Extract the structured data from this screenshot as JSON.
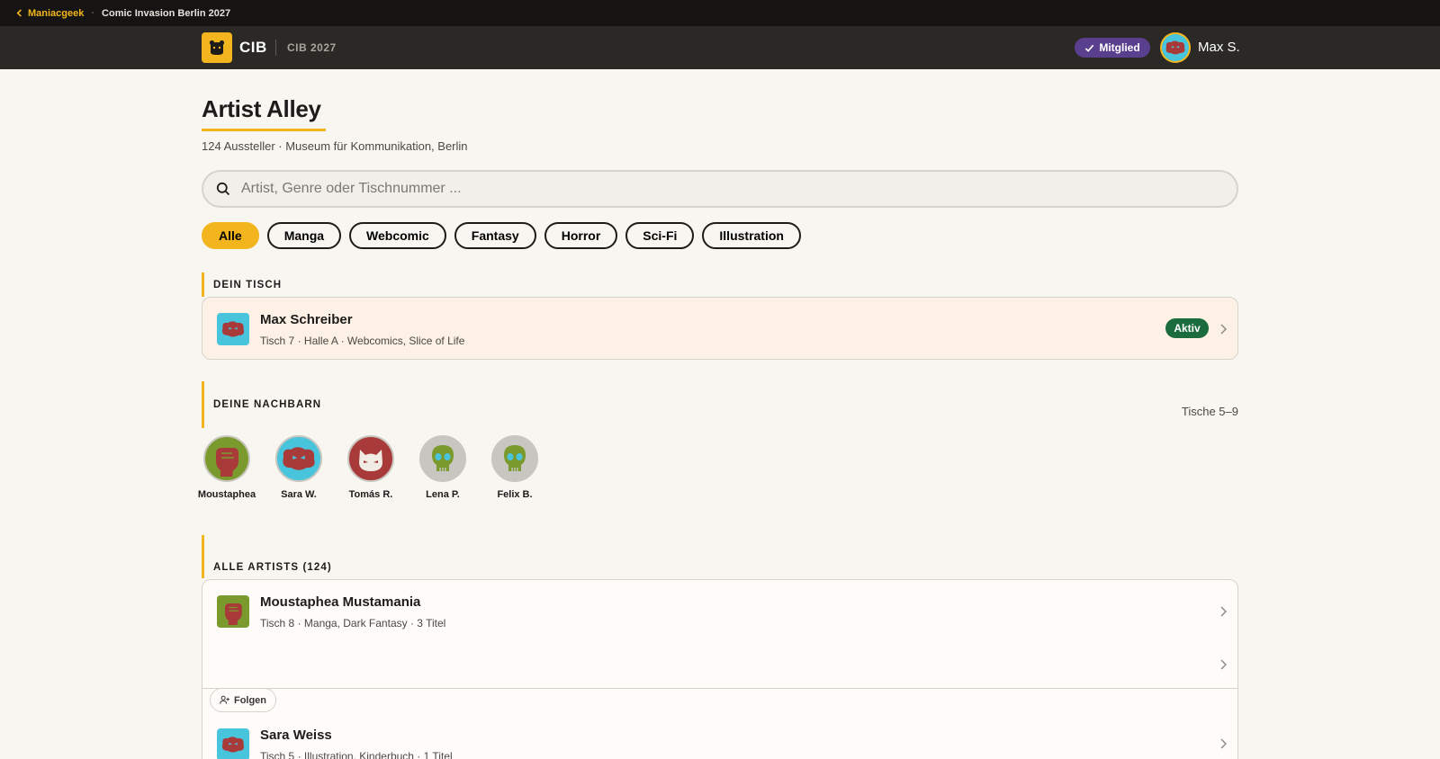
{
  "breadcrumb": {
    "back_label": "Maniacgeek",
    "separator": "·",
    "current": "Comic Invasion Berlin 2027"
  },
  "header": {
    "logo_text": "CIB",
    "logo_sub": "CIB 2027",
    "member_badge": "Mitglied",
    "user_name": "Max S."
  },
  "page": {
    "title": "Artist Alley",
    "subtitle": "124 Aussteller · Museum für Kommunikation, Berlin"
  },
  "search": {
    "placeholder": "Artist, Genre oder Tischnummer ...",
    "value": ""
  },
  "filters": [
    "Alle",
    "Manga",
    "Webcomic",
    "Fantasy",
    "Horror",
    "Sci-Fi",
    "Illustration"
  ],
  "active_filter": "Alle",
  "own_table": {
    "section_label": "DEIN TISCH",
    "name": "Max Schreiber",
    "meta": "Tisch 7 · Halle A · Webcomics, Slice of Life",
    "status": "Aktiv"
  },
  "neighbors": {
    "section_label": "DEINE NACHBARN",
    "range": "Tische 5–9",
    "items": [
      {
        "name": "Moustaphea",
        "bg": "#7a9a2e",
        "icon": "fist-icon"
      },
      {
        "name": "Sara W.",
        "bg": "#48c4dc",
        "icon": "blob-icon"
      },
      {
        "name": "Tomás R.",
        "bg": "#a83a3a",
        "icon": "cat-icon"
      },
      {
        "name": "Lena P.",
        "bg": "#c8c6c0",
        "icon": "skull-icon"
      },
      {
        "name": "Felix B.",
        "bg": "#c8c6c0",
        "icon": "skull-icon"
      }
    ]
  },
  "all_artists": {
    "section_label": "ALLE ARTISTS (124)",
    "items": [
      {
        "name": "Moustaphea Mustamania",
        "meta": "Tisch 8 · Manga, Dark Fantasy · 3 Titel"
      },
      {
        "name": "",
        "meta": ""
      },
      {
        "name": "Sara Weiss",
        "meta": "Tisch 5 · Illustration, Kinderbuch · 1 Titel"
      }
    ],
    "follow_label": "Folgen"
  },
  "colors": {
    "accent": "#f2b51d",
    "member": "#5a3f8f",
    "active": "#1a6b3e",
    "dark": "#151412"
  }
}
